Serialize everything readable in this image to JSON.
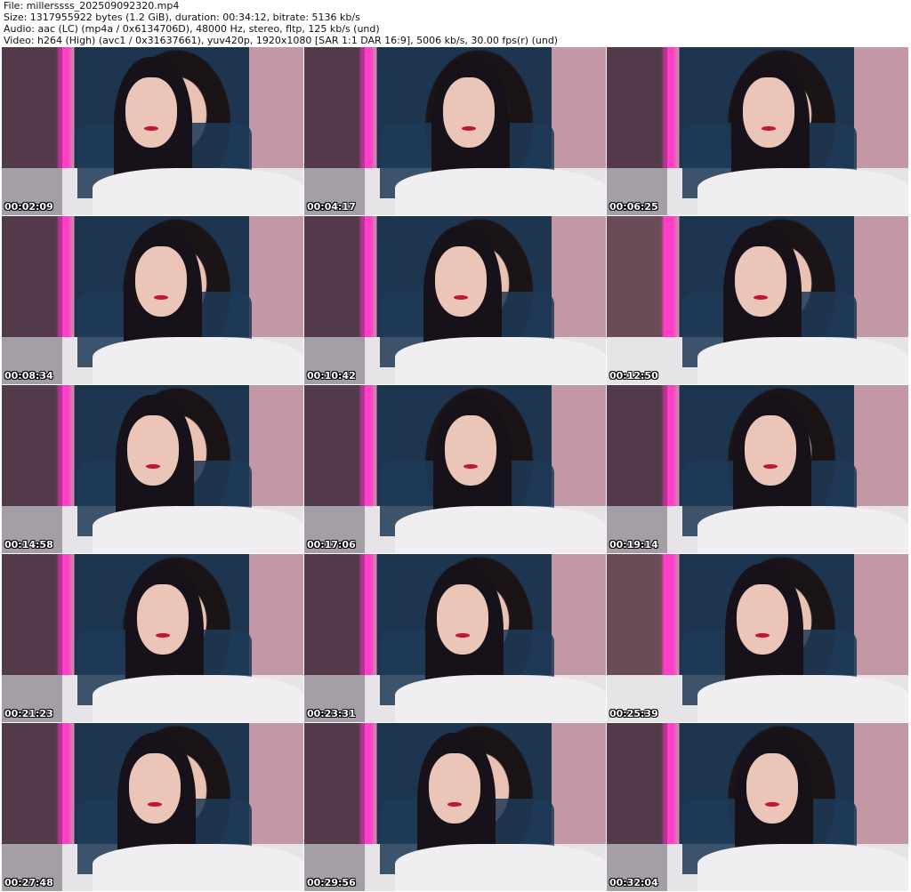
{
  "header": {
    "file": "File: millerssss_202509092320.mp4",
    "size": "Size: 1317955922 bytes (1.2 GiB), duration: 00:34:12, bitrate: 5136 kb/s",
    "audio": "Audio: aac (LC) (mp4a / 0x6134706D), 48000 Hz, stereo, fltp, 125 kb/s (und)",
    "video": "Video: h264 (High) (avc1 / 0x31637661), yuv420p, 1920x1080 [SAR 1:1 DAR 16:9], 5006 kb/s, 30.00 fps(r) (und)"
  },
  "thumbnails": [
    {
      "timestamp": "00:02:09"
    },
    {
      "timestamp": "00:04:17"
    },
    {
      "timestamp": "00:06:25"
    },
    {
      "timestamp": "00:08:34"
    },
    {
      "timestamp": "00:10:42"
    },
    {
      "timestamp": "00:12:50"
    },
    {
      "timestamp": "00:14:58"
    },
    {
      "timestamp": "00:17:06"
    },
    {
      "timestamp": "00:19:14"
    },
    {
      "timestamp": "00:21:23"
    },
    {
      "timestamp": "00:23:31"
    },
    {
      "timestamp": "00:25:39"
    },
    {
      "timestamp": "00:27:48"
    },
    {
      "timestamp": "00:29:56"
    },
    {
      "timestamp": "00:32:04"
    }
  ]
}
